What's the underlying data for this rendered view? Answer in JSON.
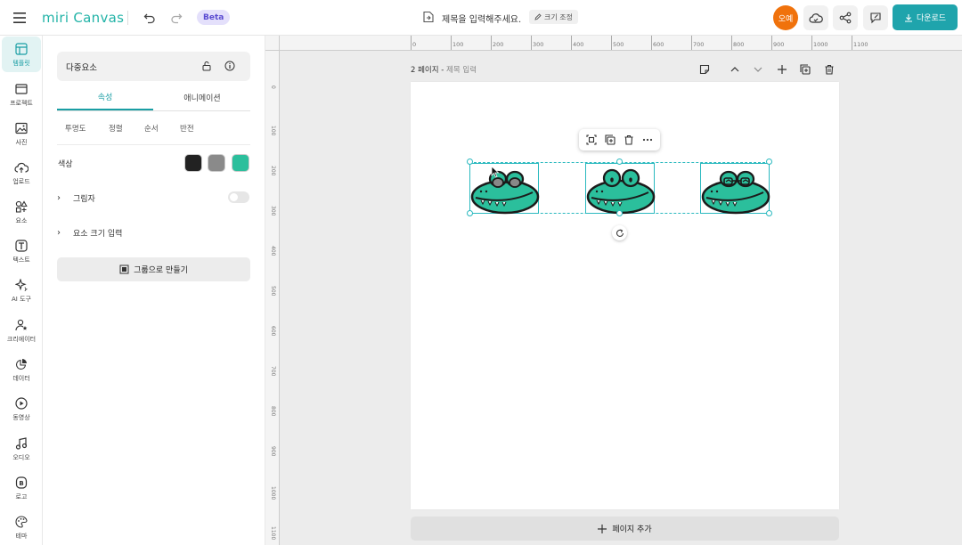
{
  "app": {
    "logo": "miri Canvas",
    "beta": "Beta"
  },
  "document": {
    "title": "제목을 입력해주세요.",
    "resize_label": "크기 조정"
  },
  "user": {
    "avatar_text": "오예"
  },
  "toolbar": {
    "download_label": "다운로드"
  },
  "rail": [
    {
      "label": "템플릿",
      "icon": "template-icon"
    },
    {
      "label": "프로젝트",
      "icon": "project-icon"
    },
    {
      "label": "사진",
      "icon": "photo-icon"
    },
    {
      "label": "업로드",
      "icon": "upload-icon"
    },
    {
      "label": "요소",
      "icon": "elements-icon"
    },
    {
      "label": "텍스트",
      "icon": "text-icon"
    },
    {
      "label": "AI 도구",
      "icon": "ai-tools-icon"
    },
    {
      "label": "크리에이터",
      "icon": "creator-icon"
    },
    {
      "label": "데이터",
      "icon": "data-icon"
    },
    {
      "label": "동영상",
      "icon": "video-icon"
    },
    {
      "label": "오디오",
      "icon": "audio-icon"
    },
    {
      "label": "로고",
      "icon": "logo-icon"
    },
    {
      "label": "테마",
      "icon": "theme-icon"
    }
  ],
  "panel": {
    "title": "다중요소",
    "tabs": [
      "속성",
      "애니메이션"
    ],
    "subtabs": [
      "투명도",
      "정렬",
      "순서",
      "반전"
    ],
    "color_label": "색상",
    "swatches": [
      "#222222",
      "#8a8a8a",
      "#2bbf9c"
    ],
    "shadow_label": "그림자",
    "size_label": "요소 크기 입력",
    "group_button": "그룹으로 만들기"
  },
  "canvas": {
    "page_number": "2 페이지 -",
    "page_title_placeholder": "제목 입력",
    "add_page": "페이지 추가",
    "ruler_h": [
      "0",
      "100",
      "200",
      "300",
      "400",
      "500",
      "600",
      "700",
      "800",
      "900",
      "1000",
      "1100"
    ],
    "ruler_v": [
      "0",
      "100",
      "200",
      "300",
      "400",
      "500",
      "600",
      "700",
      "800",
      "900",
      "1000",
      "1100"
    ]
  }
}
